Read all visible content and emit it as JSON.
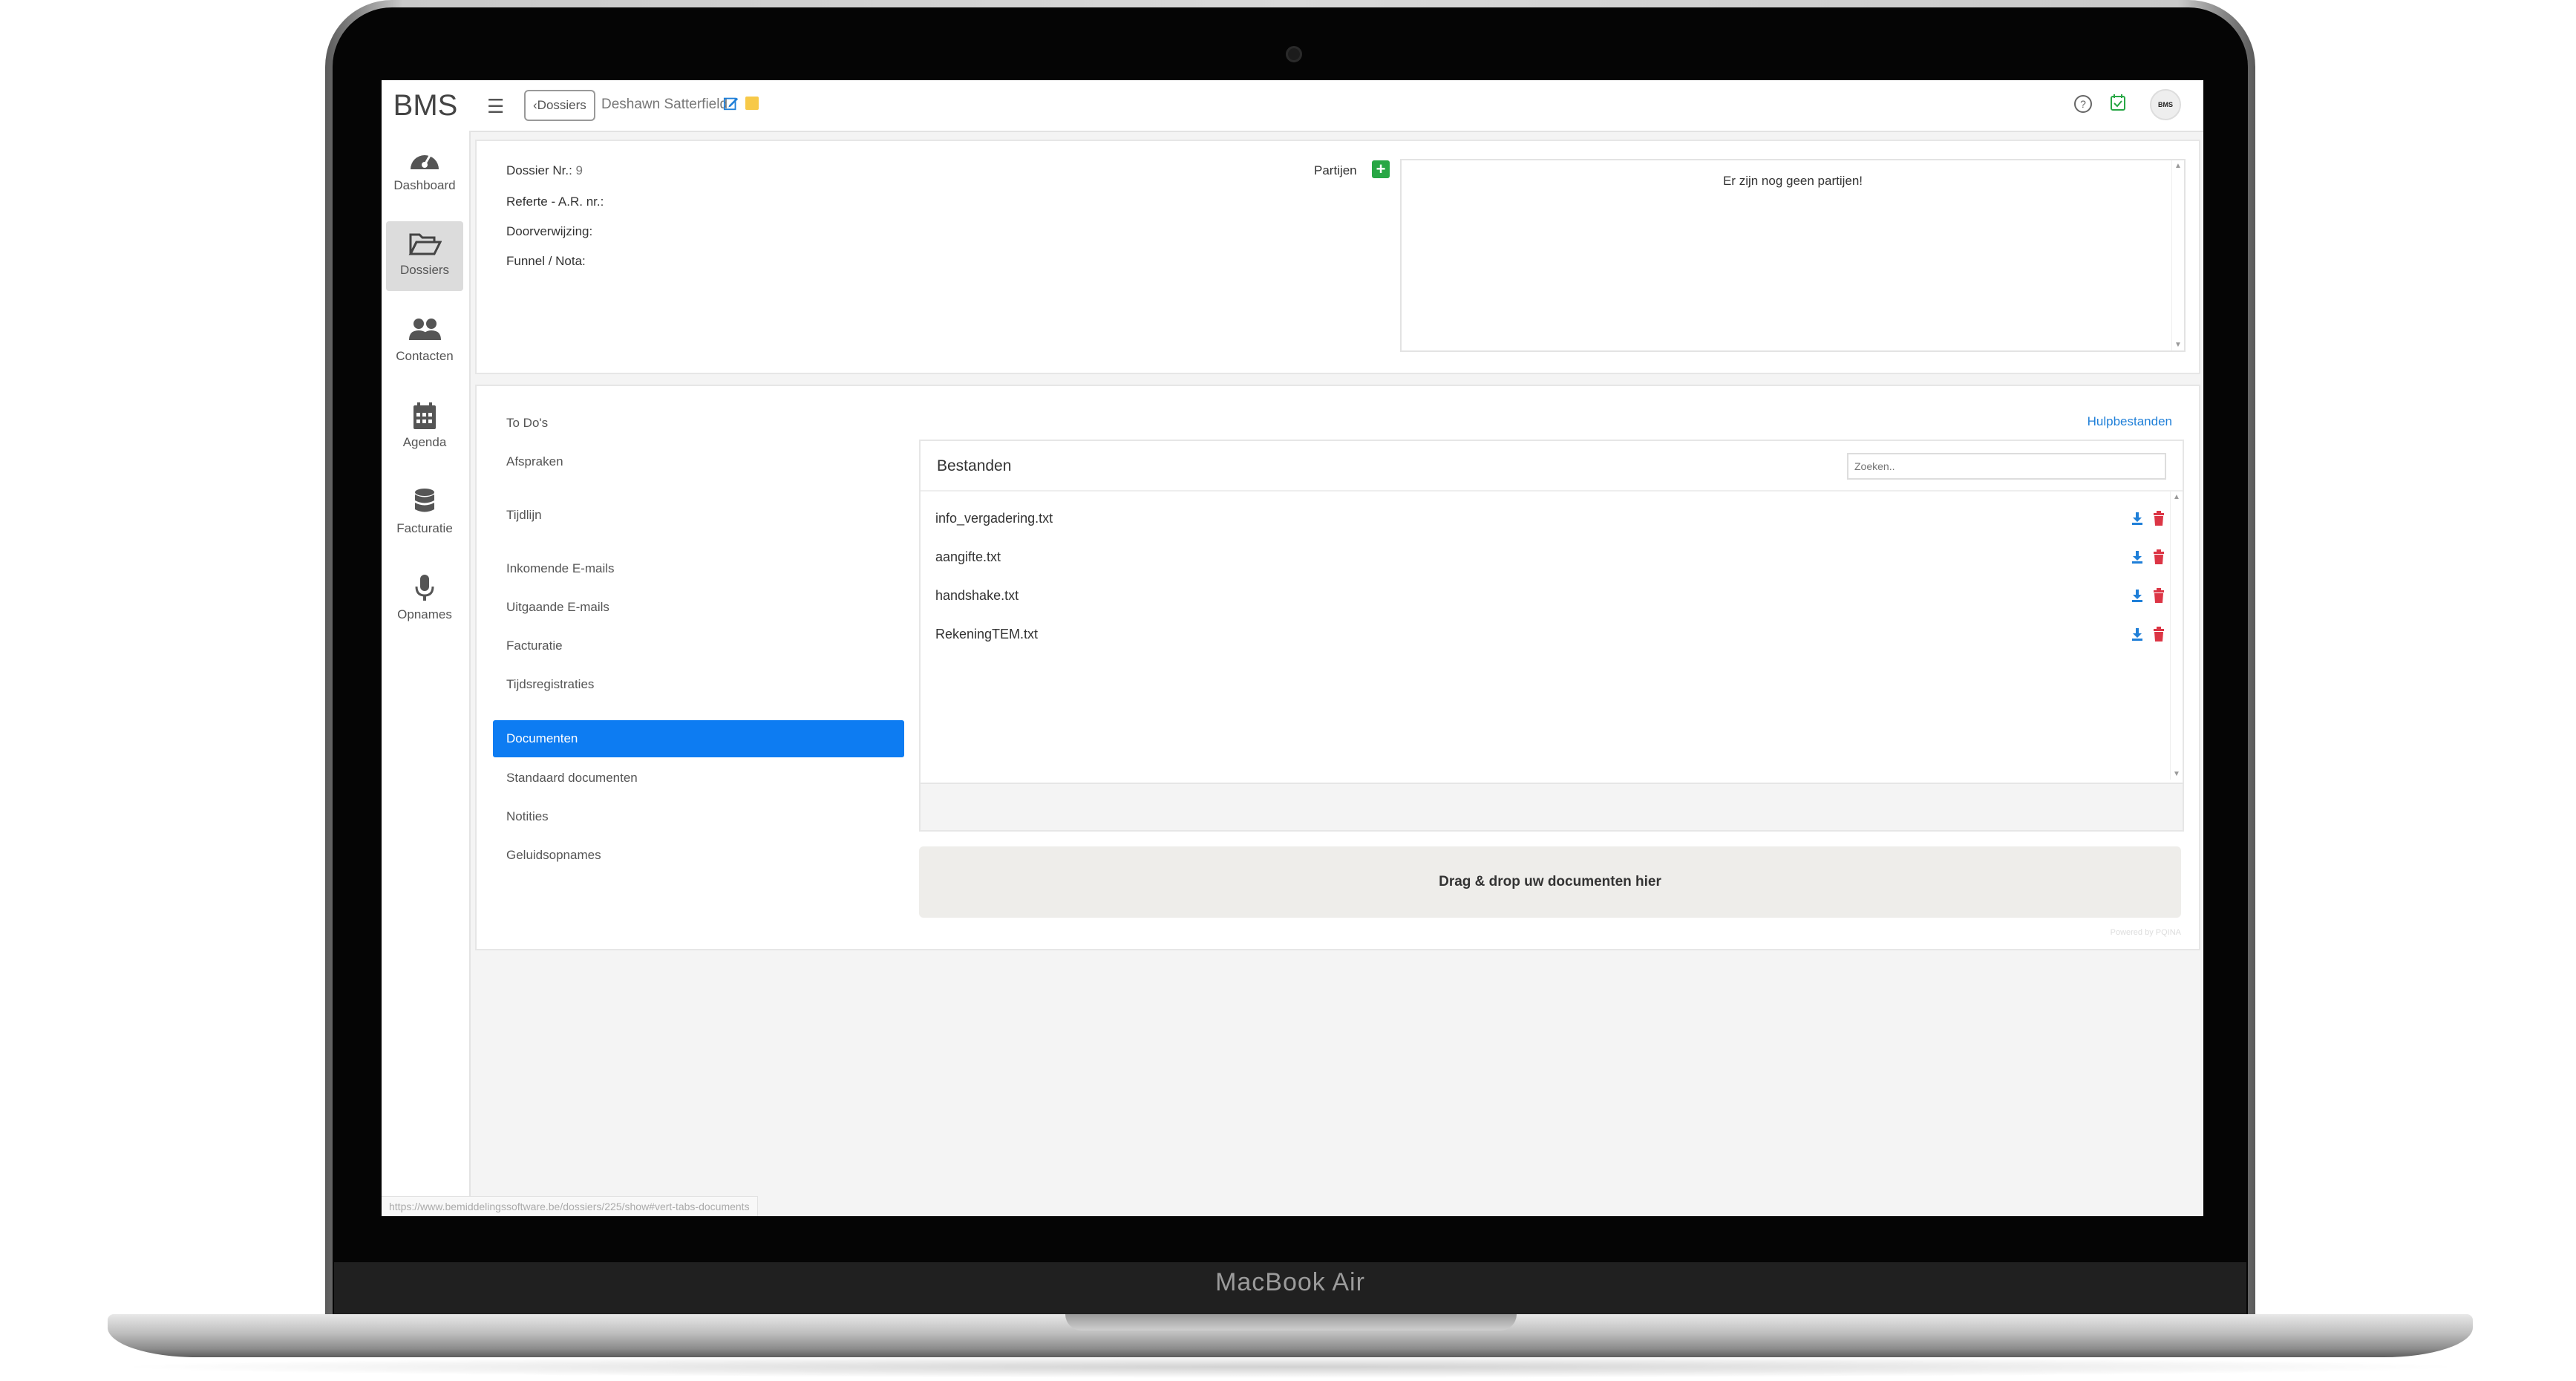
{
  "device": {
    "brand_label": "MacBook Air"
  },
  "app": {
    "logo": "BMS"
  },
  "topbar": {
    "back_label": "Dossiers",
    "client_name": "Deshawn Satterfield",
    "avatar_text": "BMS"
  },
  "sidebar": {
    "items": [
      {
        "label": "Dashboard",
        "icon": "gauge-icon"
      },
      {
        "label": "Dossiers",
        "icon": "folder-open-icon"
      },
      {
        "label": "Contacten",
        "icon": "users-icon"
      },
      {
        "label": "Agenda",
        "icon": "calendar-icon"
      },
      {
        "label": "Facturatie",
        "icon": "database-icon"
      },
      {
        "label": "Opnames",
        "icon": "microphone-icon"
      }
    ],
    "active": "Dossiers"
  },
  "dossier": {
    "nr_label": "Dossier Nr.:",
    "nr_value": "9",
    "referte_label": "Referte - A.R. nr.:",
    "doorverwijzing_label": "Doorverwijzing:",
    "funnel_label": "Funnel / Nota:",
    "partijen_label": "Partijen",
    "partijen_empty": "Er zijn nog geen partijen!"
  },
  "tabs": {
    "items": [
      "To Do's",
      "Afspraken",
      "Tijdlijn",
      "Inkomende E-mails",
      "Uitgaande E-mails",
      "Facturatie",
      "Tijdsregistraties",
      "Documenten",
      "Standaard documenten",
      "Notities",
      "Geluidsopnames"
    ],
    "active": "Documenten"
  },
  "documents": {
    "help_link": "Hulpbestanden",
    "panel_title": "Bestanden",
    "search_placeholder": "Zoeken..",
    "files": [
      "info_vergadering.txt",
      "aangifte.txt",
      "handshake.txt",
      "RekeningTEM.txt"
    ],
    "dropzone_text": "Drag & drop uw documenten hier",
    "powered_by": "Powered by PQINA"
  },
  "status_url": "https://www.bemiddelingssoftware.be/dossiers/225/show#vert-tabs-documents",
  "colors": {
    "accent": "#0d7cf2",
    "success": "#28a745",
    "danger": "#dc3545",
    "note": "#f7c948",
    "link": "#1f7fd8"
  }
}
